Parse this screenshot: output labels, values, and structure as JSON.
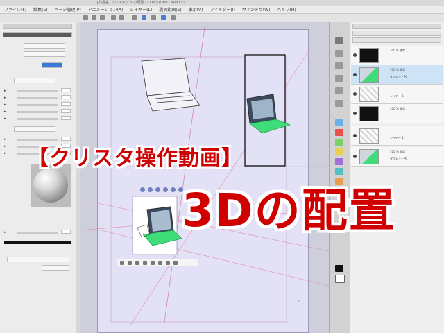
{
  "app": {
    "title_bar_text": "[作品名] クリスタ / 3Dの配置 - CLIP STUDIO PAINT EX"
  },
  "menu": [
    "ファイル(F)",
    "編集(E)",
    "ページ管理(P)",
    "アニメーション(A)",
    "レイヤー(L)",
    "選択範囲(S)",
    "表示(V)",
    "フィルター(I)",
    "ウィンドウ(W)",
    "ヘルプ(H)"
  ],
  "overlay": {
    "heading": "【クリスタ操作動画】",
    "subheading": "3Dの配置"
  },
  "layers": [
    {
      "mode": "100 % 通常",
      "name": "",
      "thumb": "black",
      "selected": false
    },
    {
      "mode": "100 % 通常",
      "name": "タブレットPC",
      "thumb": "laptop",
      "selected": true
    },
    {
      "mode": "",
      "name": "レイヤー 6",
      "thumb": "checker",
      "selected": false
    },
    {
      "mode": "100 % 通常",
      "name": "",
      "thumb": "black",
      "selected": false
    },
    {
      "mode": "",
      "name": "レイヤー 1",
      "thumb": "checker",
      "selected": false
    },
    {
      "mode": "100 % 通常",
      "name": "タブレットPC",
      "thumb": "laptop",
      "selected": false
    }
  ],
  "colors": {
    "accent_red": "#d00000",
    "paper": "#e2e1f5",
    "keyboard_green": "#3fdc7a"
  }
}
